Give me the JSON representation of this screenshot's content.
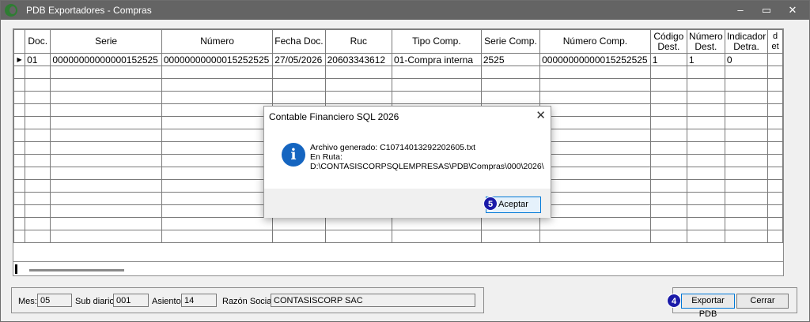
{
  "window": {
    "title": "PDB Exportadores - Compras",
    "minimize_glyph": "‒",
    "maximize_glyph": "▭",
    "close_glyph": "✕"
  },
  "grid": {
    "columns": [
      "Doc.",
      "Serie",
      "Número",
      "Fecha Doc.",
      "Ruc",
      "Tipo Comp.",
      "Serie Comp.",
      "Número Comp.",
      "Código Dest.",
      "Número Dest.",
      "Indicador Detra.",
      "d et"
    ],
    "rows": [
      [
        "01",
        "00000000000000152525",
        "00000000000015252525",
        "27/05/2026",
        "20603343612",
        "01-Compra interna",
        "2525",
        "00000000000015252525",
        "1",
        "1",
        "0",
        ""
      ]
    ],
    "selected_row_marker": "▶"
  },
  "status": {
    "mes_label": "Mes:",
    "mes_value": "05",
    "subdiario_label": "Sub diario:",
    "subdiario_value": "001",
    "asiento_label": "Asiento:",
    "asiento_value": "14",
    "razon_label": "Razón Social:",
    "razon_value": "CONTASISCORP SAC"
  },
  "buttons": {
    "exportar": "Exportar PDB",
    "cerrar": "Cerrar"
  },
  "badges": {
    "exportar_step": "4",
    "aceptar_step": "5"
  },
  "dialog": {
    "title": "Contable Financiero SQL 2026",
    "close_glyph": "✕",
    "icon_glyph": "i",
    "line1": "Archivo generado: C10714013292202605.txt",
    "line2": "En Ruta:",
    "line3": "D:\\CONTASISCORPSQLEMPRESAS\\PDB\\Compras\\000\\2026\\",
    "ok_label": "Aceptar"
  },
  "colors": {
    "titlebar": "#646464",
    "badge": "#1a1aa8",
    "info_icon": "#1565c0"
  }
}
